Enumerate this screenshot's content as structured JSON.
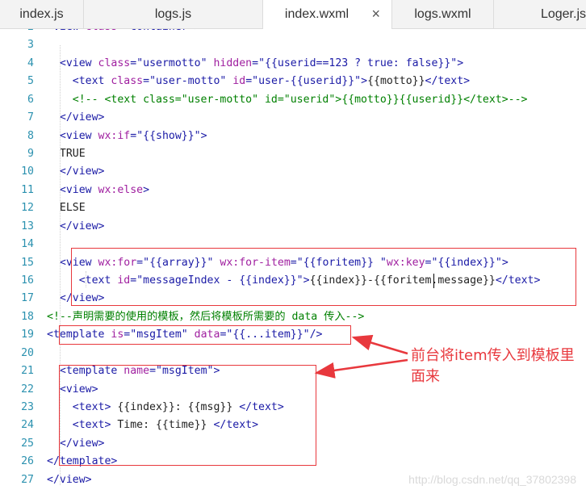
{
  "tabs": [
    {
      "label": "index.js",
      "active": false
    },
    {
      "label": "logs.js",
      "active": false
    },
    {
      "label": "index.wxml",
      "active": true,
      "close": "×"
    },
    {
      "label": "logs.wxml",
      "active": false
    },
    {
      "label": "Loger.js",
      "active": false
    }
  ],
  "lines": [
    {
      "n": "2",
      "segs": [
        [
          "t",
          "<view "
        ],
        [
          "a",
          "class"
        ],
        [
          "t",
          "="
        ],
        [
          "s",
          "\"container\""
        ],
        [
          "t",
          ">"
        ]
      ]
    },
    {
      "n": "3",
      "segs": []
    },
    {
      "n": "4",
      "segs": [
        [
          "x",
          "  "
        ],
        [
          "t",
          "<view "
        ],
        [
          "a",
          "class"
        ],
        [
          "t",
          "="
        ],
        [
          "s",
          "\"usermotto\""
        ],
        [
          "x",
          " "
        ],
        [
          "a",
          "hidden"
        ],
        [
          "t",
          "="
        ],
        [
          "s",
          "\"{{userid==123 ? true: false}}\""
        ],
        [
          "t",
          ">"
        ]
      ]
    },
    {
      "n": "5",
      "segs": [
        [
          "x",
          "    "
        ],
        [
          "t",
          "<text "
        ],
        [
          "a",
          "class"
        ],
        [
          "t",
          "="
        ],
        [
          "s",
          "\"user-motto\""
        ],
        [
          "x",
          " "
        ],
        [
          "a",
          "id"
        ],
        [
          "t",
          "="
        ],
        [
          "s",
          "\"user-{{userid}}\""
        ],
        [
          "t",
          ">"
        ],
        [
          "x",
          "{{motto}}"
        ],
        [
          "t",
          "</text>"
        ]
      ]
    },
    {
      "n": "6",
      "segs": [
        [
          "x",
          "    "
        ],
        [
          "c",
          "<!-- <text class=\"user-motto\" id=\"userid\">{{motto}}{{userid}}</text>-->"
        ]
      ]
    },
    {
      "n": "7",
      "segs": [
        [
          "x",
          "  "
        ],
        [
          "t",
          "</view>"
        ]
      ]
    },
    {
      "n": "8",
      "segs": [
        [
          "x",
          "  "
        ],
        [
          "t",
          "<view "
        ],
        [
          "a",
          "wx:if"
        ],
        [
          "t",
          "="
        ],
        [
          "s",
          "\"{{show}}\""
        ],
        [
          "t",
          ">"
        ]
      ]
    },
    {
      "n": "9",
      "segs": [
        [
          "x",
          "  TRUE"
        ]
      ]
    },
    {
      "n": "10",
      "segs": [
        [
          "x",
          "  "
        ],
        [
          "t",
          "</view>"
        ]
      ]
    },
    {
      "n": "11",
      "segs": [
        [
          "x",
          "  "
        ],
        [
          "t",
          "<view "
        ],
        [
          "a",
          "wx:else"
        ],
        [
          "t",
          ">"
        ]
      ]
    },
    {
      "n": "12",
      "segs": [
        [
          "x",
          "  ELSE"
        ]
      ]
    },
    {
      "n": "13",
      "segs": [
        [
          "x",
          "  "
        ],
        [
          "t",
          "</view>"
        ]
      ]
    },
    {
      "n": "14",
      "segs": []
    },
    {
      "n": "15",
      "segs": [
        [
          "x",
          "  "
        ],
        [
          "t",
          "<view "
        ],
        [
          "a",
          "wx:for"
        ],
        [
          "t",
          "="
        ],
        [
          "s",
          "\"{{array}}\""
        ],
        [
          "x",
          " "
        ],
        [
          "a",
          "wx:for-item"
        ],
        [
          "t",
          "="
        ],
        [
          "s",
          "\"{{foritem}} \""
        ],
        [
          "a",
          "wx:key"
        ],
        [
          "t",
          "="
        ],
        [
          "s",
          "\"{{index}}\""
        ],
        [
          "t",
          ">"
        ]
      ]
    },
    {
      "n": "16",
      "segs": [
        [
          "x",
          "     "
        ],
        [
          "t",
          "<text "
        ],
        [
          "a",
          "id"
        ],
        [
          "t",
          "="
        ],
        [
          "s",
          "\"messageIndex - {{index}}\""
        ],
        [
          "t",
          ">"
        ],
        [
          "x",
          "{{index}}-{{foritem.message}}"
        ],
        [
          "t",
          "</text>"
        ]
      ]
    },
    {
      "n": "17",
      "segs": [
        [
          "x",
          "  "
        ],
        [
          "t",
          "</view>"
        ]
      ]
    },
    {
      "n": "18",
      "segs": [
        [
          "c",
          "<!--声明需要的使用的模板，然后将模板所需要的 data 传入-->"
        ]
      ]
    },
    {
      "n": "19",
      "segs": [
        [
          "t",
          "<template "
        ],
        [
          "a",
          "is"
        ],
        [
          "t",
          "="
        ],
        [
          "s",
          "\"msgItem\""
        ],
        [
          "x",
          " "
        ],
        [
          "a",
          "data"
        ],
        [
          "t",
          "="
        ],
        [
          "s",
          "\"{{...item}}\""
        ],
        [
          "t",
          "/>"
        ]
      ]
    },
    {
      "n": "20",
      "segs": []
    },
    {
      "n": "21",
      "segs": [
        [
          "x",
          "  "
        ],
        [
          "t",
          "<template "
        ],
        [
          "a",
          "name"
        ],
        [
          "t",
          "="
        ],
        [
          "s",
          "\"msgItem\""
        ],
        [
          "t",
          ">"
        ]
      ]
    },
    {
      "n": "22",
      "segs": [
        [
          "x",
          "  "
        ],
        [
          "t",
          "<view>"
        ]
      ]
    },
    {
      "n": "23",
      "segs": [
        [
          "x",
          "    "
        ],
        [
          "t",
          "<text>"
        ],
        [
          "x",
          " {{index}}: {{msg}} "
        ],
        [
          "t",
          "</text>"
        ]
      ]
    },
    {
      "n": "24",
      "segs": [
        [
          "x",
          "    "
        ],
        [
          "t",
          "<text>"
        ],
        [
          "x",
          " Time: {{time}} "
        ],
        [
          "t",
          "</text>"
        ]
      ]
    },
    {
      "n": "25",
      "segs": [
        [
          "x",
          "  "
        ],
        [
          "t",
          "</view>"
        ]
      ]
    },
    {
      "n": "26",
      "segs": [
        [
          "t",
          "</template>"
        ]
      ]
    },
    {
      "n": "27",
      "segs": [
        [
          "t",
          "</view>"
        ]
      ]
    }
  ],
  "annotation": "前台将item传入到模板里面来",
  "watermark": "http://blog.csdn.net/qq_37802398",
  "colors": {
    "annotation": "#e8383d",
    "tag": "#1a1aa6",
    "attr": "#a020a0",
    "comment": "#008000",
    "lineNumber": "#2b91af"
  }
}
